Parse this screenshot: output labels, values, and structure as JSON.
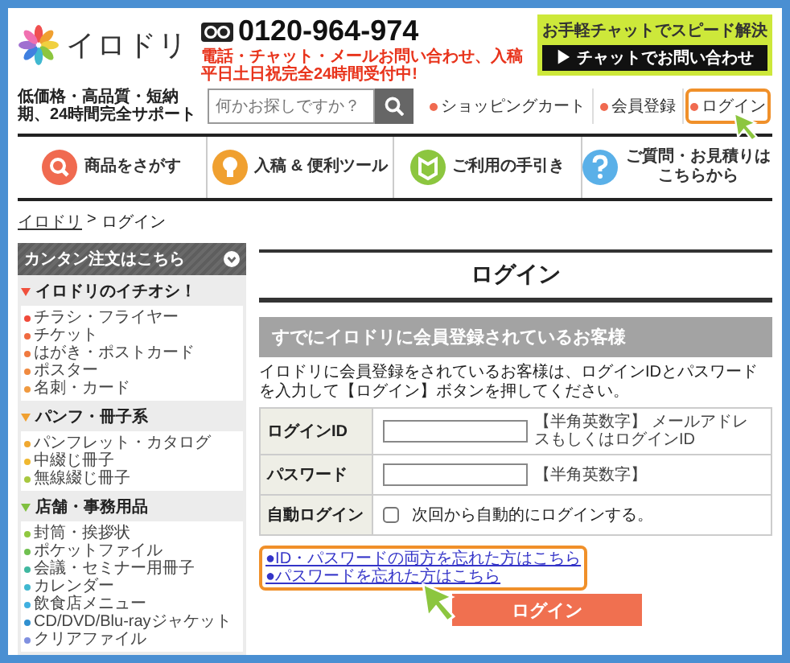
{
  "header": {
    "logo": {
      "name": "イロドリ"
    },
    "tagline": "低価格・高品質・短納期、24時間完全サポート",
    "phone": "0120-964-974",
    "hours": [
      "電話・チャット・メールお問い合わせ、入稿",
      "平日土日祝完全24時間受付中!"
    ],
    "chat": {
      "title": "お手軽チャットでスピード解決",
      "button": "▶ チャットでお問い合わせ"
    },
    "search": {
      "placeholder": "何かお探しですか？"
    },
    "links": [
      {
        "label": "ショッピングカート",
        "highlighted": false
      },
      {
        "label": "会員登録",
        "highlighted": false
      },
      {
        "label": "ログイン",
        "highlighted": true
      }
    ]
  },
  "nav": [
    {
      "kind": "search",
      "label": "商品をさがす"
    },
    {
      "kind": "bulb",
      "label": "入稿 & 便利ツール"
    },
    {
      "kind": "guide",
      "label": "ご利用の手引き"
    },
    {
      "kind": "help",
      "label": "ご質問・お見積りはこちらから"
    }
  ],
  "breadcrumb": {
    "separator": ">",
    "items": [
      {
        "label": "イロドリ",
        "link": true
      },
      {
        "label": "ログイン",
        "link": false
      }
    ]
  },
  "sidebar": {
    "title": "カンタン注文はこちら",
    "sections": [
      {
        "title": "イロドリのイチオシ！",
        "color": "#f0503c",
        "items": [
          {
            "label": "チラシ・フライヤー",
            "color": "#f04a3a"
          },
          {
            "label": "チケット",
            "color": "#f06a40"
          },
          {
            "label": "はがき・ポストカード",
            "color": "#f07a40"
          },
          {
            "label": "ポスター",
            "color": "#f08a40"
          },
          {
            "label": "名刺・カード",
            "color": "#f09a40"
          }
        ]
      },
      {
        "title": "パンフ・冊子系",
        "color": "#f0a030",
        "items": [
          {
            "label": "パンフレット・カタログ",
            "color": "#f0a830"
          },
          {
            "label": "中綴じ冊子",
            "color": "#f0b830"
          },
          {
            "label": "無線綴じ冊子",
            "color": "#a8c840"
          }
        ]
      },
      {
        "title": "店舗・事務用品",
        "color": "#80c040",
        "items": [
          {
            "label": "封筒・挨拶状",
            "color": "#90c840"
          },
          {
            "label": "ポケットファイル",
            "color": "#70c050"
          },
          {
            "label": "会議・セミナー用冊子",
            "color": "#40b8a0"
          },
          {
            "label": "カレンダー",
            "color": "#40b8d0"
          },
          {
            "label": "飲食店メニュー",
            "color": "#40b0e0"
          },
          {
            "label": "CD/DVD/Blu-rayジャケット",
            "color": "#3090d0"
          },
          {
            "label": "クリアファイル",
            "color": "#8090e0"
          }
        ]
      }
    ]
  },
  "main": {
    "title": "ログイン",
    "heading": "すでにイロドリに会員登録されているお客様",
    "intro": "イロドリに会員登録をされているお客様は、ログインIDとパスワードを入力して【ログイン】ボタンを押してください。",
    "fields": [
      {
        "kind": "text",
        "label": "ログインID",
        "note": "【半角英数字】 メールアドレスもしくはログインID"
      },
      {
        "kind": "password",
        "label": "パスワード",
        "note": "【半角英数字】"
      },
      {
        "kind": "checkbox",
        "label": "自動ログイン",
        "option": "次回から自動的にログインする。",
        "checked": false
      }
    ],
    "links": {
      "highlighted": true,
      "items": [
        "●ID・パスワードの両方を忘れた方はこちら",
        "●パスワードを忘れた方はこちら"
      ]
    },
    "button": "ログイン"
  }
}
